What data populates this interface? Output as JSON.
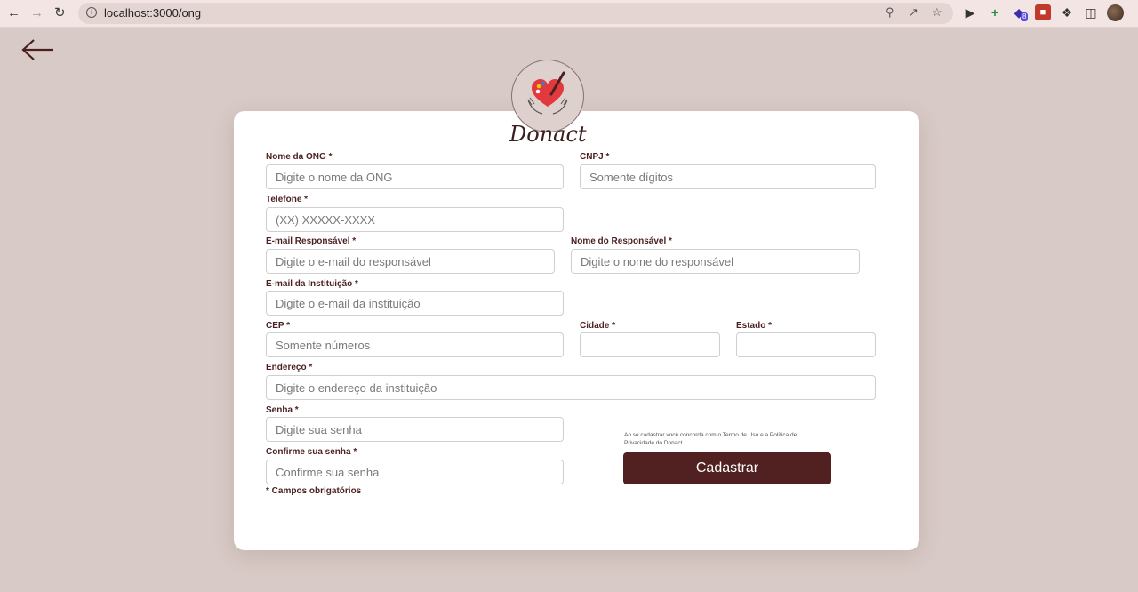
{
  "browser": {
    "url": "localhost:3000/ong",
    "extension_badge": "8"
  },
  "brand": {
    "name": "Donact"
  },
  "form": {
    "nome_ong": {
      "label": "Nome da ONG *",
      "placeholder": "Digite o nome da ONG"
    },
    "cnpj": {
      "label": "CNPJ *",
      "placeholder": "Somente dígitos"
    },
    "telefone": {
      "label": "Telefone *",
      "placeholder": "(XX) XXXXX-XXXX"
    },
    "email_responsavel": {
      "label": "E-mail Responsável *",
      "placeholder": "Digite o e-mail do responsável"
    },
    "nome_responsavel": {
      "label": "Nome do Responsável *",
      "placeholder": "Digite o nome do responsável"
    },
    "email_instituicao": {
      "label": "E-mail da Instituição *",
      "placeholder": "Digite o e-mail da instituição"
    },
    "cep": {
      "label": "CEP *",
      "placeholder": "Somente números"
    },
    "cidade": {
      "label": "Cidade *",
      "placeholder": ""
    },
    "estado": {
      "label": "Estado *",
      "placeholder": ""
    },
    "endereco": {
      "label": "Endereço *",
      "placeholder": "Digite o endereço da instituição"
    },
    "senha": {
      "label": "Senha *",
      "placeholder": "Digite sua senha"
    },
    "confirme_senha": {
      "label": "Confirme sua senha *",
      "placeholder": "Confirme sua senha"
    },
    "required_note": "* Campos obrigatórios",
    "terms_text": "Ao se cadastrar você concorda com o Termo de Uso e a Política de Privacidade do Donact",
    "submit_label": "Cadastrar"
  }
}
